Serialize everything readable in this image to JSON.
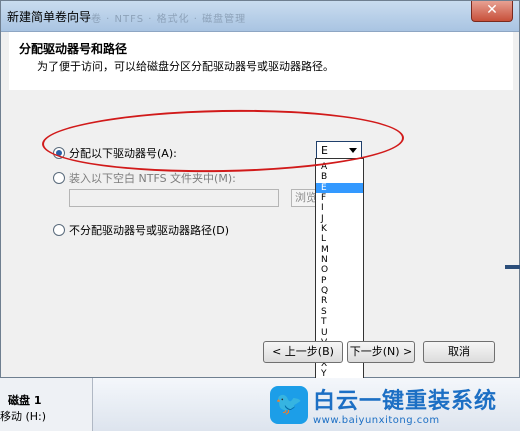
{
  "window": {
    "title": "新建简单卷向导",
    "title_faded": "卷 · NTFS · 格式化  ·  磁盘管理",
    "close_glyph": "✕"
  },
  "header": {
    "title": "分配驱动器号和路径",
    "subtitle": "为了便于访问，可以给磁盘分区分配驱动器号或驱动器路径。"
  },
  "options": {
    "assign_letter": "分配以下驱动器号(A):",
    "mount_folder": "装入以下空白 NTFS 文件夹中(M):",
    "no_assign": "不分配驱动器号或驱动器路径(D)"
  },
  "drive_select": {
    "selected": "E",
    "list": [
      "A",
      "B",
      "E",
      "F",
      "I",
      "J",
      "K",
      "L",
      "M",
      "N",
      "O",
      "P",
      "Q",
      "R",
      "S",
      "T",
      "U",
      "V",
      "W",
      "X",
      "Y",
      "Z"
    ],
    "highlighted": "E"
  },
  "browse_label": "浏览(R)...",
  "buttons": {
    "back": "< 上一步(B)",
    "next": "下一步(N) >",
    "cancel": "取消"
  },
  "disk_manager": {
    "disk": "磁盘 1",
    "volume": "移动 (H:)"
  },
  "watermark": {
    "logo_glyph": "🐦",
    "main": "白云一键重装系统",
    "url": "www.baiyunxitong.com"
  },
  "colors": {
    "accent": "#3399ff",
    "highlight_circle": "#d11a1a",
    "watermark": "#1c6fc4"
  }
}
